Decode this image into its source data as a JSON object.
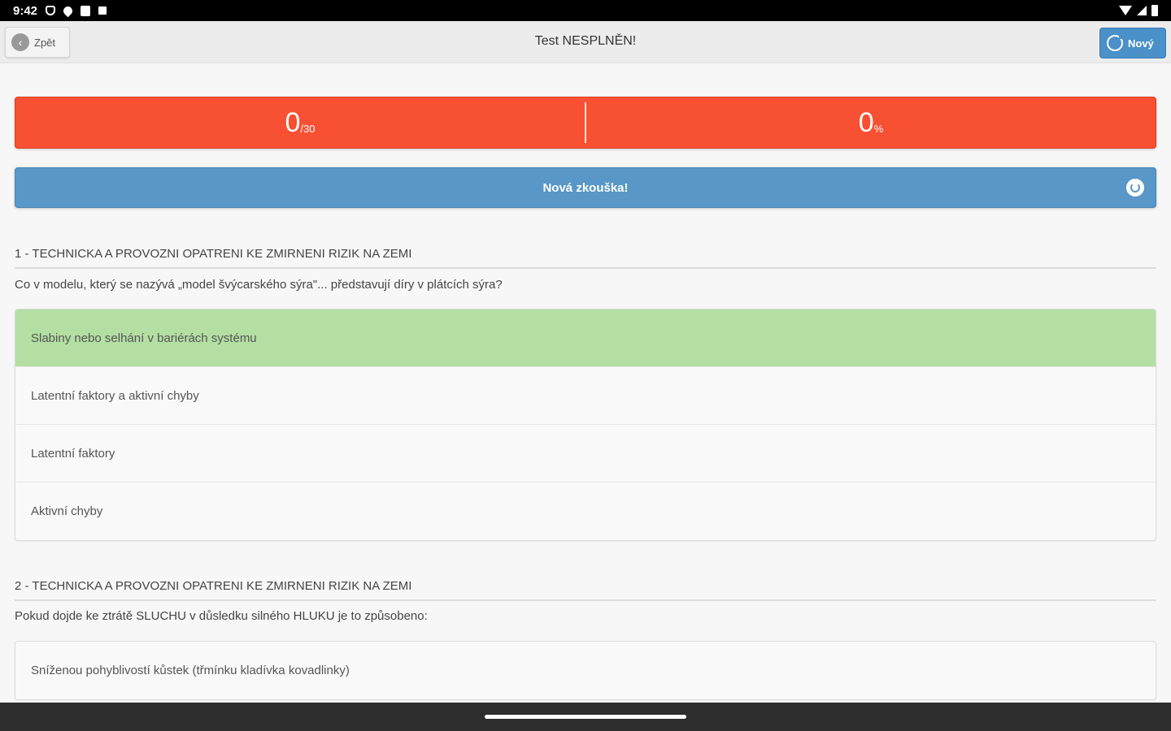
{
  "status_bar": {
    "time": "9:42"
  },
  "header": {
    "back_label": "Zpět",
    "title": "Test NESPLNĚN!",
    "new_label": "Nový"
  },
  "score": {
    "correct": "0",
    "total": "/30",
    "percent": "0",
    "percent_sign": "%"
  },
  "retry": {
    "label": "Nová zkouška!"
  },
  "colors": {
    "fail": "#f85032",
    "primary": "#5897c7",
    "correct_answer": "#b3dfa3"
  },
  "questions": [
    {
      "section": "1 - TECHNICKA A PROVOZNI OPATRENI KE ZMIRNENI RIZIK NA ZEMI",
      "text": "Co v modelu, který se nazývá „model švýcarského sýra\"... představují díry v plátcích sýra?",
      "answers": [
        {
          "label": "Slabiny nebo selhání v bariérách systému",
          "correct": true
        },
        {
          "label": "Latentní faktory a aktivní chyby",
          "correct": false
        },
        {
          "label": "Latentní faktory",
          "correct": false
        },
        {
          "label": "Aktivní chyby",
          "correct": false
        }
      ]
    },
    {
      "section": "2 - TECHNICKA A PROVOZNI OPATRENI KE ZMIRNENI RIZIK NA ZEMI",
      "text": "Pokud dojde ke ztrátě SLUCHU v důsledku silného HLUKU je to způsobeno:",
      "answers": [
        {
          "label": "Sníženou pohyblivostí kůstek (třmínku kladívka kovadlinky)",
          "correct": false
        }
      ]
    }
  ]
}
